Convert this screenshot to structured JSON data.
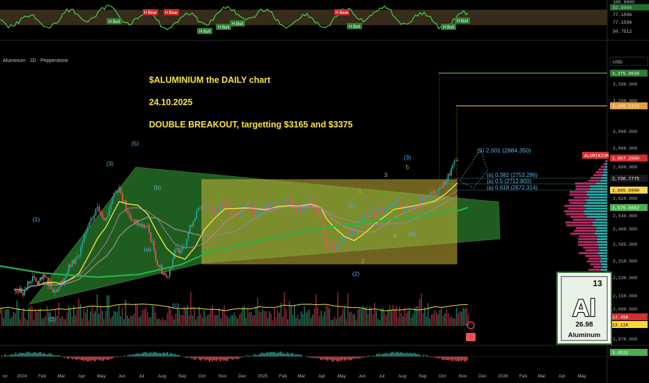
{
  "symbol_line": "Aluminium · 1D · Pepperstone",
  "currency": "USD",
  "annotation": {
    "line1": "$ALUMINIUM   the DAILY chart",
    "line2": "24.10.2025",
    "line3": "DOUBLE BREAKOUT, targetting $3165 and $3375"
  },
  "price_axis": {
    "ticks": [
      "3,300.000",
      "3,200.000",
      "3,000.000",
      "2,900.000",
      "2,800.000",
      "2,620.000",
      "2,540.000",
      "2,460.000",
      "2,385.000",
      "2,310.000",
      "2,230.000",
      "2,150.000",
      "2,090.000",
      "1,970.000"
    ],
    "badges": [
      {
        "label": "3,375.9540",
        "color": "#2e7d32"
      },
      {
        "label": "3,165.1372",
        "color": "#e0a040"
      },
      {
        "label": "ALUMINIUM",
        "color": "#d32f2f"
      },
      {
        "label": "2,857.2000",
        "color": "#d32f2f"
      },
      {
        "label": "2,736.7775",
        "color": "#1a1a1a"
      },
      {
        "label": "2,665.0990",
        "color": "#ffd54f"
      },
      {
        "label": "2,575.5662",
        "color": "#4caf50"
      },
      {
        "label": "14.45K",
        "color": "#d32f2f"
      },
      {
        "label": "13.11K",
        "color": "#fdd835"
      },
      {
        "label": "3.4531",
        "color": "#4caf50"
      }
    ]
  },
  "oscillator": {
    "values": [
      "100.0000",
      "82.9608",
      "77.1596",
      "77.1596",
      "50.7512"
    ],
    "badges": [
      "H Bull",
      "H Bull",
      "H Bull",
      "H Bull",
      "H Bear",
      "H Bear",
      "H Bear",
      "H Bull",
      "H Bull",
      "H Bull"
    ]
  },
  "time_axis": [
    "2024",
    "Feb",
    "Mar",
    "Apr",
    "May",
    "Jun",
    "Jul",
    "Aug",
    "Sep",
    "Oct",
    "Nov",
    "Dec",
    "2025",
    "Feb",
    "Mar",
    "Apr",
    "May",
    "Jun",
    "Jul",
    "Aug",
    "Sep",
    "Oct",
    "Nov",
    "Dec",
    "2026",
    "Feb",
    "Mar",
    "Apr",
    "May"
  ],
  "wave_labels": [
    "(1)",
    "(3)",
    "(5)",
    "(b)",
    "(a)",
    "(c)",
    "(2)",
    "(2)",
    "(1)",
    "(3)",
    "(4)",
    "(5) 2.001 (2884.350)",
    "1",
    "2",
    "3",
    "4",
    "5"
  ],
  "fib_labels": [
    "(a) 0.382 (2753.286)",
    "(a) 0.5 (2712.800)",
    "(a) 0.618 (2672.314)"
  ],
  "element_card": {
    "number": "13",
    "symbol": "Al",
    "mass": "26.98",
    "name": "Aluminum"
  },
  "chart_data": {
    "type": "candlestick",
    "title": "$ALUMINIUM the DAILY chart",
    "targets": [
      3165,
      3375
    ],
    "last_price": 2857.2,
    "ylim": [
      1970,
      3376
    ],
    "path": [
      [
        "2023-12-20",
        2180
      ],
      [
        "2024-01-05",
        2170
      ],
      [
        "2024-01-15",
        2230
      ],
      [
        "2024-01-25",
        2205
      ],
      [
        "2024-02-05",
        2230
      ],
      [
        "2024-02-20",
        2175
      ],
      [
        "2024-03-01",
        2205
      ],
      [
        "2024-03-15",
        2290
      ],
      [
        "2024-03-28",
        2340
      ],
      [
        "2024-04-10",
        2470
      ],
      [
        "2024-04-25",
        2580
      ],
      [
        "2024-05-08",
        2520
      ],
      [
        "2024-05-20",
        2650
      ],
      [
        "2024-05-28",
        2680
      ],
      [
        "2024-06-10",
        2540
      ],
      [
        "2024-06-25",
        2490
      ],
      [
        "2024-07-10",
        2470
      ],
      [
        "2024-07-25",
        2300
      ],
      [
        "2024-08-08",
        2230
      ],
      [
        "2024-08-20",
        2345
      ],
      [
        "2024-09-05",
        2395
      ],
      [
        "2024-09-20",
        2540
      ],
      [
        "2024-10-05",
        2585
      ],
      [
        "2024-10-20",
        2570
      ],
      [
        "2024-11-05",
        2590
      ],
      [
        "2024-11-20",
        2540
      ],
      [
        "2024-12-05",
        2600
      ],
      [
        "2024-12-20",
        2560
      ],
      [
        "2025-01-05",
        2565
      ],
      [
        "2025-01-25",
        2600
      ],
      [
        "2025-02-10",
        2615
      ],
      [
        "2025-02-25",
        2555
      ],
      [
        "2025-03-15",
        2600
      ],
      [
        "2025-03-30",
        2545
      ],
      [
        "2025-04-08",
        2380
      ],
      [
        "2025-04-20",
        2370
      ],
      [
        "2025-05-05",
        2420
      ],
      [
        "2025-05-20",
        2445
      ],
      [
        "2025-06-05",
        2540
      ],
      [
        "2025-06-20",
        2560
      ],
      [
        "2025-07-05",
        2575
      ],
      [
        "2025-07-20",
        2600
      ],
      [
        "2025-08-05",
        2570
      ],
      [
        "2025-08-20",
        2590
      ],
      [
        "2025-09-05",
        2625
      ],
      [
        "2025-09-20",
        2650
      ],
      [
        "2025-10-05",
        2710
      ],
      [
        "2025-10-24",
        2857
      ]
    ]
  }
}
